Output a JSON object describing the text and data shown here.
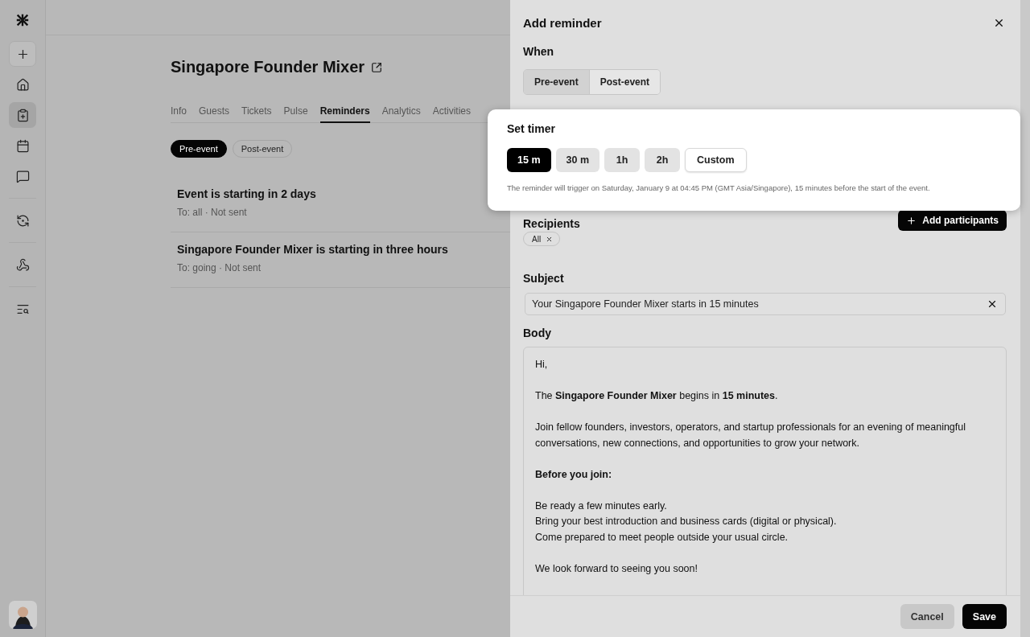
{
  "sidebar": {
    "groups": [
      {
        "items": [
          {
            "kind": "add",
            "selected": false
          },
          {
            "kind": "home",
            "selected": false
          },
          {
            "kind": "events",
            "selected": true
          },
          {
            "kind": "calendar",
            "selected": false
          },
          {
            "kind": "chat",
            "selected": false
          }
        ]
      },
      {
        "items": [
          {
            "kind": "insights",
            "selected": false
          }
        ]
      },
      {
        "items": [
          {
            "kind": "webhook",
            "selected": false
          }
        ]
      },
      {
        "items": [
          {
            "kind": "search-list",
            "selected": false
          }
        ]
      }
    ]
  },
  "event": {
    "title": "Singapore Founder Mixer",
    "tabs": [
      {
        "label": "Info",
        "selected": false
      },
      {
        "label": "Guests",
        "selected": false
      },
      {
        "label": "Tickets",
        "selected": false
      },
      {
        "label": "Pulse",
        "selected": false
      },
      {
        "label": "Reminders",
        "selected": true
      },
      {
        "label": "Analytics",
        "selected": false
      },
      {
        "label": "Activities",
        "selected": false
      }
    ],
    "filters": [
      {
        "label": "Pre-event",
        "selected": true
      },
      {
        "label": "Post-event",
        "selected": false
      }
    ],
    "reminders": [
      {
        "title": "Event is starting in 2 days",
        "meta": "To: all · Not sent"
      },
      {
        "title": "Singapore Founder Mixer is starting in three hours",
        "meta": "To: going · Not sent"
      }
    ]
  },
  "drawer": {
    "title": "Add reminder",
    "when_label": "When",
    "when_options": [
      {
        "label": "Pre-event",
        "selected": true
      },
      {
        "label": "Post-event",
        "selected": false
      }
    ],
    "timer": {
      "title": "Set timer",
      "options": [
        {
          "label": "15 m",
          "kind": "preset",
          "selected": true
        },
        {
          "label": "30 m",
          "kind": "preset",
          "selected": false
        },
        {
          "label": "1h",
          "kind": "preset",
          "selected": false
        },
        {
          "label": "2h",
          "kind": "preset",
          "selected": false
        },
        {
          "label": "Custom",
          "kind": "custom",
          "selected": false
        }
      ],
      "note": "The reminder will trigger on Saturday, January 9 at 04:45 PM (GMT Asia/Singapore), 15 minutes before the start of the event."
    },
    "recipients_label": "Recipients",
    "add_participants": "Add participants",
    "recipients": [
      "All"
    ],
    "subject_label": "Subject",
    "subject": "Your Singapore Founder Mixer starts in 15 minutes",
    "body_label": "Body",
    "body": [
      {
        "kind": "text",
        "lines": [
          "Hi,"
        ]
      },
      {
        "kind": "text",
        "lines": [
          "The **Singapore Founder Mixer** begins in **15 minutes**."
        ]
      },
      {
        "kind": "text",
        "lines": [
          "Join fellow founders, investors, operators, and startup professionals for an evening of meaningful conversations, new connections, and opportunities to grow your network."
        ]
      },
      {
        "kind": "heading",
        "lines": [
          "Before you join:"
        ]
      },
      {
        "kind": "text",
        "lines": [
          "Be ready a few minutes early.",
          "Bring your best introduction and business cards (digital or physical).",
          "Come prepared to meet people outside your usual circle."
        ]
      },
      {
        "kind": "text",
        "lines": [
          "We look forward to seeing you soon!"
        ]
      }
    ],
    "cancel": "Cancel",
    "save": "Save"
  }
}
